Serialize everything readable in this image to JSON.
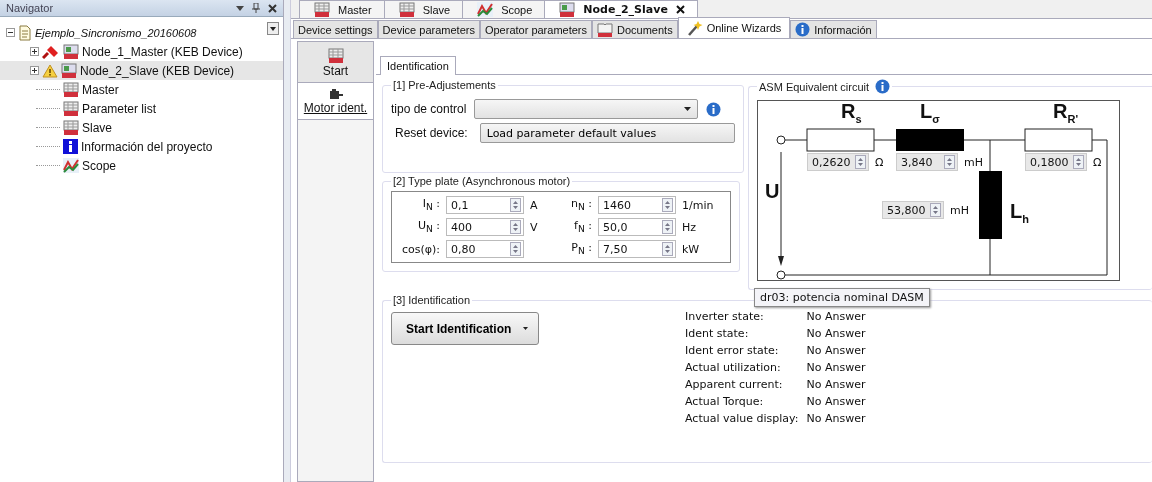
{
  "navigator": {
    "title": "Navigator",
    "tree": [
      {
        "label": "Ejemplo_Sincronismo_20160608",
        "kind": "project",
        "expanded": true,
        "selected": false,
        "children": [
          {
            "label": "Node_1_Master (KEB Device)",
            "kind": "device",
            "connected": true,
            "warning": false,
            "expanded": false,
            "selected": false
          },
          {
            "label": "Node_2_Slave (KEB Device)",
            "kind": "device",
            "connected": false,
            "warning": true,
            "expanded": false,
            "selected": true
          },
          {
            "label": "Master",
            "kind": "keb",
            "selected": false
          },
          {
            "label": "Parameter list",
            "kind": "keb",
            "selected": false
          },
          {
            "label": "Slave",
            "kind": "keb",
            "selected": false
          },
          {
            "label": "Información del proyecto",
            "kind": "info",
            "selected": false
          },
          {
            "label": "Scope",
            "kind": "scope",
            "selected": false
          }
        ]
      }
    ]
  },
  "doc_tabs": [
    {
      "label": "Master",
      "kind": "keb",
      "selected": false
    },
    {
      "label": "Slave",
      "kind": "keb",
      "selected": false
    },
    {
      "label": "Scope",
      "kind": "scope",
      "selected": false
    },
    {
      "label": "Node_2_Slave",
      "kind": "device",
      "selected": true
    }
  ],
  "sub_tabs": [
    {
      "label": "Device settings",
      "selected": false
    },
    {
      "label": "Device parameters",
      "selected": false
    },
    {
      "label": "Operator parameters",
      "selected": false
    },
    {
      "label": "Documents",
      "kind": "documents",
      "selected": false
    },
    {
      "label": "Online Wizards",
      "kind": "wizard",
      "selected": true
    },
    {
      "label": "Información",
      "kind": "info-round",
      "selected": false
    }
  ],
  "wizard_steps": [
    {
      "label": "Start",
      "kind": "keb",
      "selected": false
    },
    {
      "label": "Motor ident.",
      "kind": "motor",
      "selected": true
    }
  ],
  "content_tabs": [
    {
      "label": "Identification",
      "selected": true
    }
  ],
  "pre_adjustments": {
    "title": "[1] Pre-Adjustements",
    "control_label": "tipo de control",
    "reset_label": "Reset device:",
    "reset_button": "Load parameter default values"
  },
  "type_plate": {
    "title": "[2] Type plate (Asynchronous motor)",
    "fields": [
      {
        "label": "I$_{N}$ :",
        "value": "0,1",
        "unit": "A"
      },
      {
        "label": "n$_{N}$ :",
        "value": "1460",
        "unit": "1/min"
      },
      {
        "label": "U$_{N}$ :",
        "value": "400",
        "unit": "V"
      },
      {
        "label": "f$_{N}$ :",
        "value": "50,0",
        "unit": "Hz"
      },
      {
        "label": "cos(φ):",
        "value": "0,80"
      },
      {
        "label": "P$_{N}$ :",
        "value": "7,50",
        "unit": "kW"
      }
    ]
  },
  "circuit": {
    "title": "ASM Equivalent circuit",
    "labels": [
      "R$_{s}$",
      "L$_{σ}$",
      "R$_{R'}$",
      "U",
      "L$_{h}$"
    ],
    "fields": [
      {
        "value": "0,2620",
        "unit": "Ω"
      },
      {
        "value": "3,840",
        "unit": "mH"
      },
      {
        "value": "0,1800",
        "unit": "Ω"
      },
      {
        "value": "53,800",
        "unit": "mH"
      }
    ]
  },
  "identification": {
    "title": "[3] Identification",
    "button": "Start Identification",
    "status": [
      {
        "label": "Inverter state:",
        "value": "No Answer"
      },
      {
        "label": "Ident state:",
        "value": "No Answer"
      },
      {
        "label": "Ident error state:",
        "value": "No Answer"
      },
      {
        "label": "Actual utilization:",
        "value": "No Answer"
      },
      {
        "label": "Apparent current:",
        "value": "No Answer"
      },
      {
        "label": "Actual Torque:",
        "value": "No Answer"
      },
      {
        "label": "Actual value display:",
        "value": "No Answer"
      }
    ]
  },
  "tooltip": "dr03: potencia nominal DASM"
}
